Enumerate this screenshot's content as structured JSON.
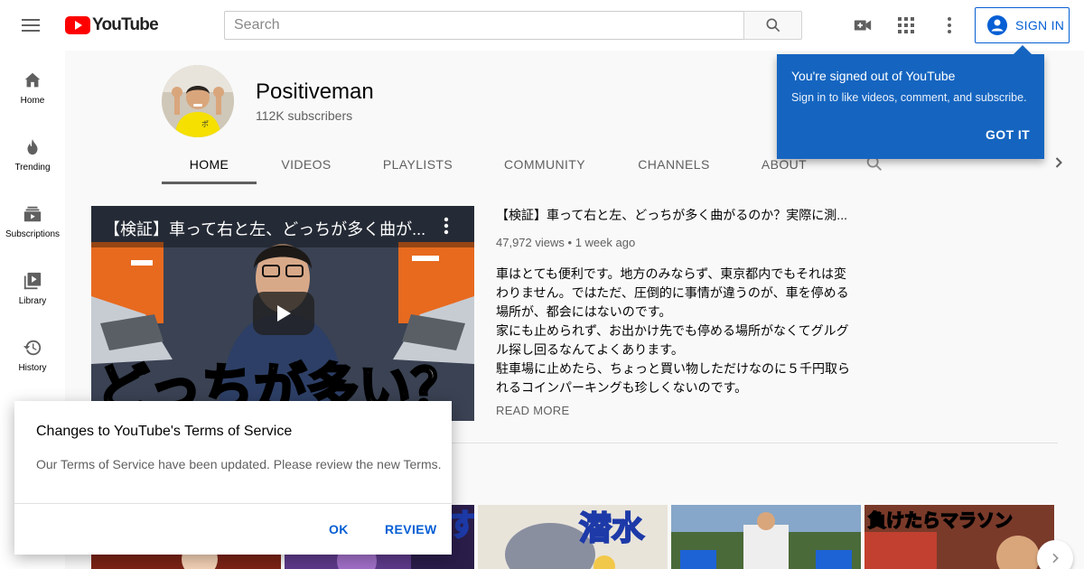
{
  "masthead": {
    "logo_text": "YouTube",
    "search_placeholder": "Search",
    "signin_label": "SIGN IN",
    "icons": [
      "menu-icon",
      "search-icon",
      "video-camera-plus-icon",
      "apps-grid-icon",
      "more-vert-icon",
      "account-circle-icon"
    ]
  },
  "sidebar": {
    "items": [
      {
        "label": "Home",
        "icon": "home-icon"
      },
      {
        "label": "Trending",
        "icon": "flame-icon"
      },
      {
        "label": "Subscriptions",
        "icon": "subscriptions-icon"
      },
      {
        "label": "Library",
        "icon": "library-icon"
      },
      {
        "label": "History",
        "icon": "history-icon"
      }
    ]
  },
  "channel": {
    "name": "Positiveman",
    "subscribers": "112K subscribers",
    "tabs": [
      {
        "label": "HOME",
        "active": true
      },
      {
        "label": "VIDEOS",
        "active": false
      },
      {
        "label": "PLAYLISTS",
        "active": false
      },
      {
        "label": "COMMUNITY",
        "active": false
      },
      {
        "label": "CHANNELS",
        "active": false
      },
      {
        "label": "ABOUT",
        "active": false
      }
    ]
  },
  "featured": {
    "overlay_title": "【検証】車って右と左、どっちが多く曲が...",
    "thumbnail_text": "どっちが多い？",
    "title": "【検証】車って右と左、どっちが多く曲がるのか？実際に測...",
    "views": "47,972 views",
    "age": "1 week ago",
    "description": [
      "車はとても便利です。地方のみならず、東京都内でもそれは変",
      "わりません。ではただ、圧倒的に事情が違うのが、車を停める",
      "場所が、都会にはないのです。",
      "家にも止められず、お出かけ先でも停める場所がなくてグルグ",
      "ル探し回るなんてよくあります。",
      "駐車場に止めたら、ちょっと買い物しただけなのに５千円取ら",
      "れるコインパーキングも珍しくないのです。"
    ],
    "read_more": "READ MORE"
  },
  "shelf": {
    "thumbnails": [
      {
        "text": ""
      },
      {
        "text": ""
      },
      {
        "text": "潜水"
      },
      {
        "text": ""
      },
      {
        "text": "負けたらマラソン"
      }
    ]
  },
  "signed_out_popup": {
    "title": "You're signed out of YouTube",
    "body": "Sign in to like videos, comment, and subscribe.",
    "button": "GOT IT"
  },
  "terms_dialog": {
    "title": "Changes to YouTube's Terms of Service",
    "body": "Our Terms of Service have been updated. Please review the new Terms.",
    "ok": "OK",
    "review": "REVIEW"
  },
  "colors": {
    "brand_red": "#ff0000",
    "accent_blue": "#065fd4",
    "popup_blue": "#1565c0"
  }
}
